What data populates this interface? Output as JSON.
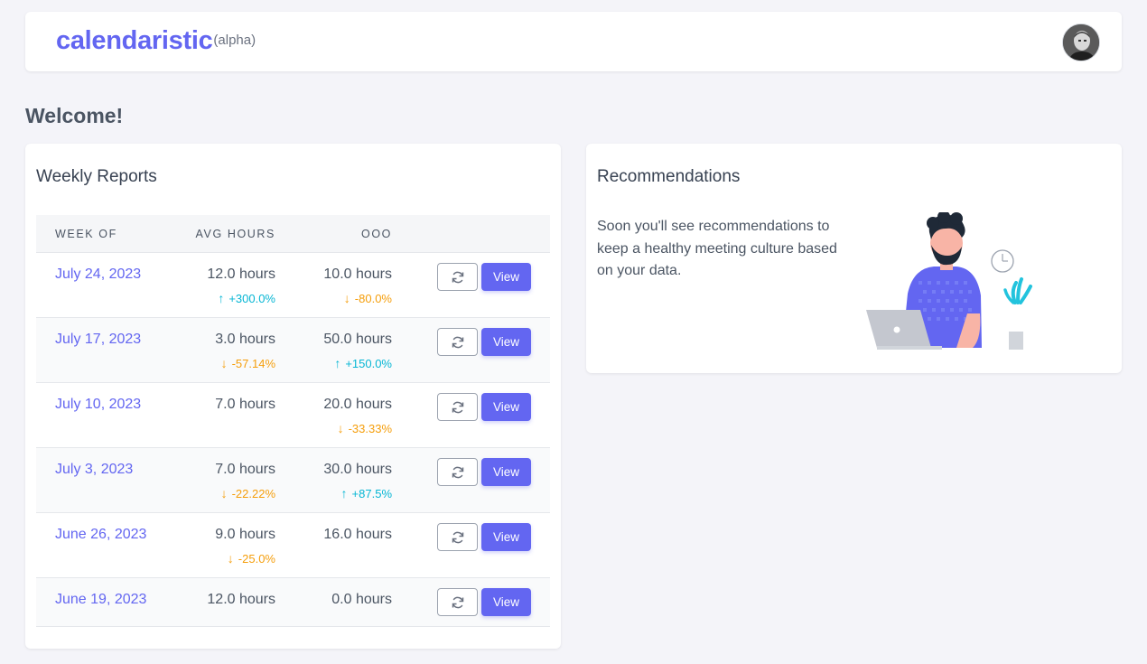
{
  "app": {
    "name": "calendaristic",
    "tag": "(alpha)"
  },
  "welcome": "Welcome!",
  "reports": {
    "title": "Weekly Reports",
    "columns": {
      "week": "WEEK OF",
      "avg": "AVG HOURS",
      "ooo": "OOO"
    },
    "rows": [
      {
        "week": "July 24, 2023",
        "avg": "12.0 hours",
        "avg_delta": "+300.0%",
        "avg_dir": "up",
        "ooo": "10.0 hours",
        "ooo_delta": "-80.0%",
        "ooo_dir": "down",
        "view": "View"
      },
      {
        "week": "July 17, 2023",
        "avg": "3.0 hours",
        "avg_delta": "-57.14%",
        "avg_dir": "down",
        "ooo": "50.0 hours",
        "ooo_delta": "+150.0%",
        "ooo_dir": "up",
        "view": "View"
      },
      {
        "week": "July 10, 2023",
        "avg": "7.0 hours",
        "avg_delta": "",
        "avg_dir": "",
        "ooo": "20.0 hours",
        "ooo_delta": "-33.33%",
        "ooo_dir": "down",
        "view": "View"
      },
      {
        "week": "July 3, 2023",
        "avg": "7.0 hours",
        "avg_delta": "-22.22%",
        "avg_dir": "down",
        "ooo": "30.0 hours",
        "ooo_delta": "+87.5%",
        "ooo_dir": "up",
        "view": "View"
      },
      {
        "week": "June 26, 2023",
        "avg": "9.0 hours",
        "avg_delta": "-25.0%",
        "avg_dir": "down",
        "ooo": "16.0 hours",
        "ooo_delta": "",
        "ooo_dir": "",
        "view": "View"
      },
      {
        "week": "June 19, 2023",
        "avg": "12.0 hours",
        "avg_delta": "",
        "avg_dir": "",
        "ooo": "0.0 hours",
        "ooo_delta": "",
        "ooo_dir": "",
        "view": "View"
      }
    ]
  },
  "recommendations": {
    "title": "Recommendations",
    "text": "Soon you'll see recommendations to keep a healthy meeting culture based on your data."
  },
  "icons": {
    "refresh": "refresh-icon",
    "up": "arrow-up-icon",
    "down": "arrow-down-icon"
  },
  "colors": {
    "accent": "#6366f1",
    "up": "#06b6d4",
    "down": "#f59e0b"
  }
}
